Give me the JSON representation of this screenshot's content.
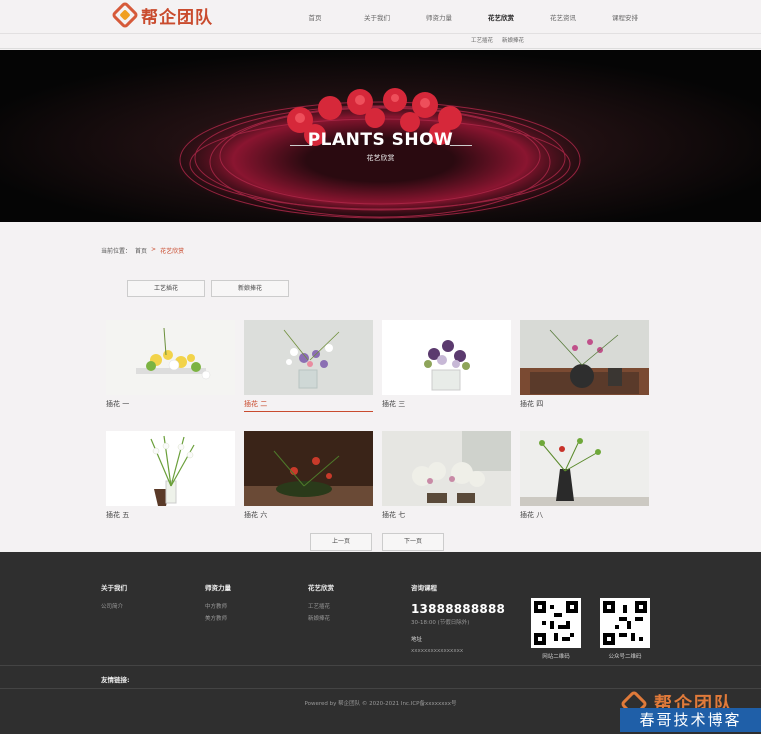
{
  "header": {
    "logo_text": "帮企团队",
    "nav": [
      {
        "label": "首页"
      },
      {
        "label": "关于我们"
      },
      {
        "label": "师资力量"
      },
      {
        "label": "花艺欣赏",
        "active": true
      },
      {
        "label": "花艺资讯"
      },
      {
        "label": "课程安排"
      }
    ],
    "subnav": [
      "工艺插花",
      "新娘捧花"
    ]
  },
  "banner": {
    "title": "PLANTS SHOW",
    "subtitle": "花艺欣赏"
  },
  "breadcrumb": {
    "label": "当前位置：",
    "home": "首页",
    "sep": ">",
    "current": "花艺欣赏"
  },
  "categories": [
    "工艺插花",
    "新娘捧花"
  ],
  "items": [
    {
      "caption": "插花 一"
    },
    {
      "caption": "插花 二",
      "active": true
    },
    {
      "caption": "插花 三"
    },
    {
      "caption": "插花 四"
    },
    {
      "caption": "插花 五"
    },
    {
      "caption": "插花 六"
    },
    {
      "caption": "插花 七"
    },
    {
      "caption": "插花 八"
    }
  ],
  "pagination": {
    "prev": "上一页",
    "next": "下一页"
  },
  "footer": {
    "about": {
      "title": "关于我们",
      "links": [
        "公司简介"
      ]
    },
    "teachers": {
      "title": "师资力量",
      "links": [
        "中方教师",
        "美方教师"
      ]
    },
    "appreciation": {
      "title": "花艺欣赏",
      "links": [
        "工艺插花",
        "新娘捧花"
      ]
    },
    "consult": {
      "title": "咨询课程",
      "phone": "13888888888",
      "hours": "30-18:00 (节假日除外)",
      "address_label": "地址",
      "address": "xxxxxxxxxxxxxxxx"
    },
    "qr": [
      {
        "caption": "网站二维码"
      },
      {
        "caption": "公众号二维码"
      }
    ],
    "friends_label": "友情链接:",
    "copyright": "Powered by 帮企团队 © 2020-2021 Inc.ICP备xxxxxxxx号"
  },
  "watermark": {
    "text": "春哥技术博客",
    "logo": "帮企团队"
  },
  "colors": {
    "accent": "#c94b2e",
    "footer_bg": "#2f2f2f",
    "page_bg": "#f4f2f3"
  }
}
